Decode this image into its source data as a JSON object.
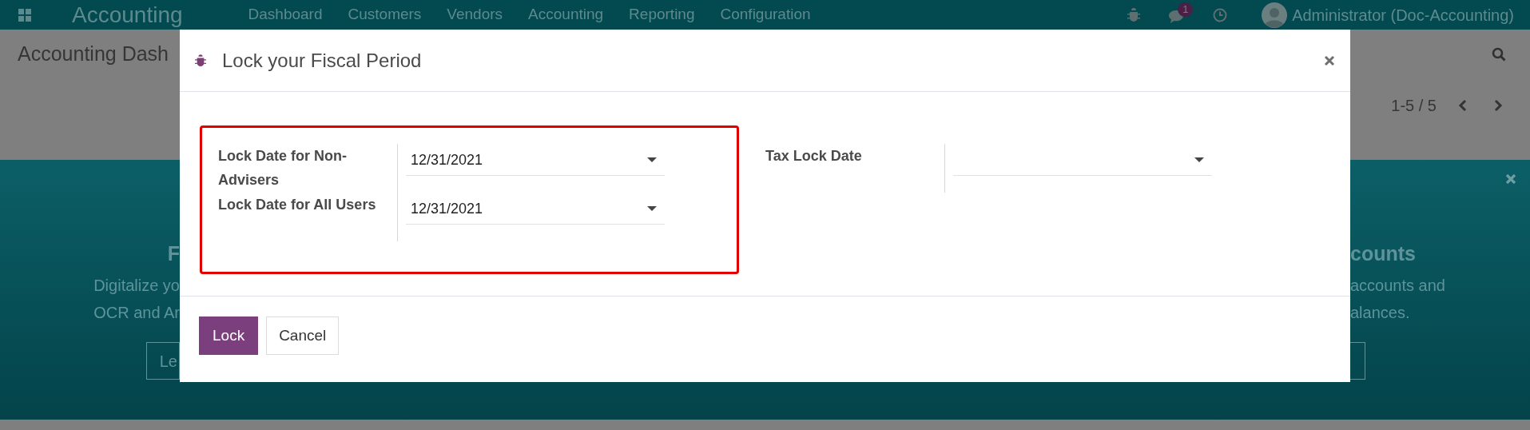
{
  "navbar": {
    "app_name": "Accounting",
    "menu": [
      "Dashboard",
      "Customers",
      "Vendors",
      "Accounting",
      "Reporting",
      "Configuration"
    ],
    "message_count": "1",
    "user": "Administrator (Doc-Accounting)"
  },
  "control_panel": {
    "title": "Accounting Dash",
    "pager": "1-5 / 5"
  },
  "banner": {
    "left": {
      "heading": "F",
      "lines": [
        "Digitalize yo",
        "OCR and Ar"
      ],
      "button": "Le"
    },
    "right": {
      "heading": "counts",
      "lines": [
        "accounts and",
        "alances."
      ]
    }
  },
  "dialog": {
    "title": "Lock your Fiscal Period",
    "groups": [
      {
        "highlighted": true,
        "fields": [
          {
            "label": "Lock Date for Non-Advisers",
            "value": "12/31/2021"
          },
          {
            "label": "Lock Date for All Users",
            "value": "12/31/2021"
          }
        ]
      },
      {
        "highlighted": false,
        "fields": [
          {
            "label": "Tax Lock Date"
          }
        ]
      }
    ],
    "buttons": [
      {
        "label": "Lock",
        "kind": "primary"
      },
      {
        "label": "Cancel",
        "kind": "secondary"
      }
    ]
  }
}
